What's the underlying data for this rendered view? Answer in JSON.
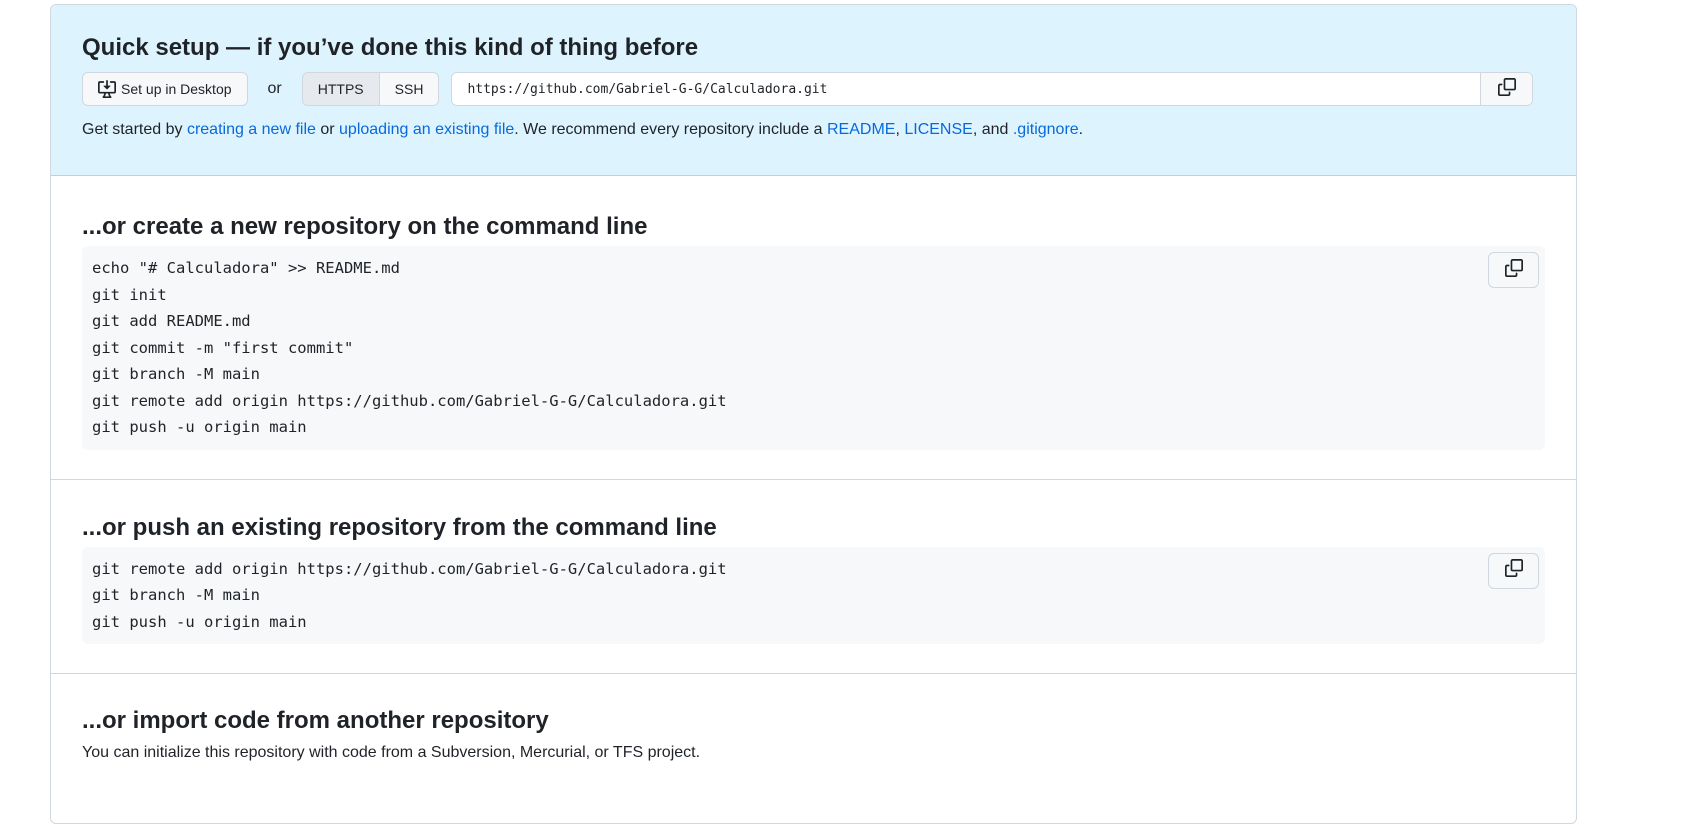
{
  "quick_setup": {
    "title": "Quick setup — if you’ve done this kind of thing before",
    "desktop_button": "Set up in Desktop",
    "or": "or",
    "protocols": [
      "HTTPS",
      "SSH"
    ],
    "selected_protocol": "HTTPS",
    "clone_url": "https://github.com/Gabriel-G-G/Calculadora.git",
    "hint": {
      "p1": "Get started by ",
      "link1": "creating a new file",
      "p2": " or ",
      "link2": "uploading an existing file",
      "p3": ". We recommend every repository include a ",
      "link3": "README",
      "p4": ", ",
      "link4": "LICENSE",
      "p5": ", and ",
      "link5": ".gitignore",
      "p6": "."
    }
  },
  "new_repo": {
    "title": "...or create a new repository on the command line",
    "lines": [
      "echo \"# Calculadora\" >> README.md",
      "git init",
      "git add README.md",
      "git commit -m \"first commit\"",
      "git branch -M main",
      "git remote add origin https://github.com/Gabriel-G-G/Calculadora.git",
      "git push -u origin main"
    ]
  },
  "push_existing": {
    "title": "...or push an existing repository from the command line",
    "lines": [
      "git remote add origin https://github.com/Gabriel-G-G/Calculadora.git",
      "git branch -M main",
      "git push -u origin main"
    ]
  },
  "import": {
    "title": "...or import code from another repository",
    "text": "You can initialize this repository with code from a Subversion, Mercurial, or TFS project."
  },
  "icons": {
    "desktop": "desktop-download-icon",
    "copy": "copy-icon"
  }
}
